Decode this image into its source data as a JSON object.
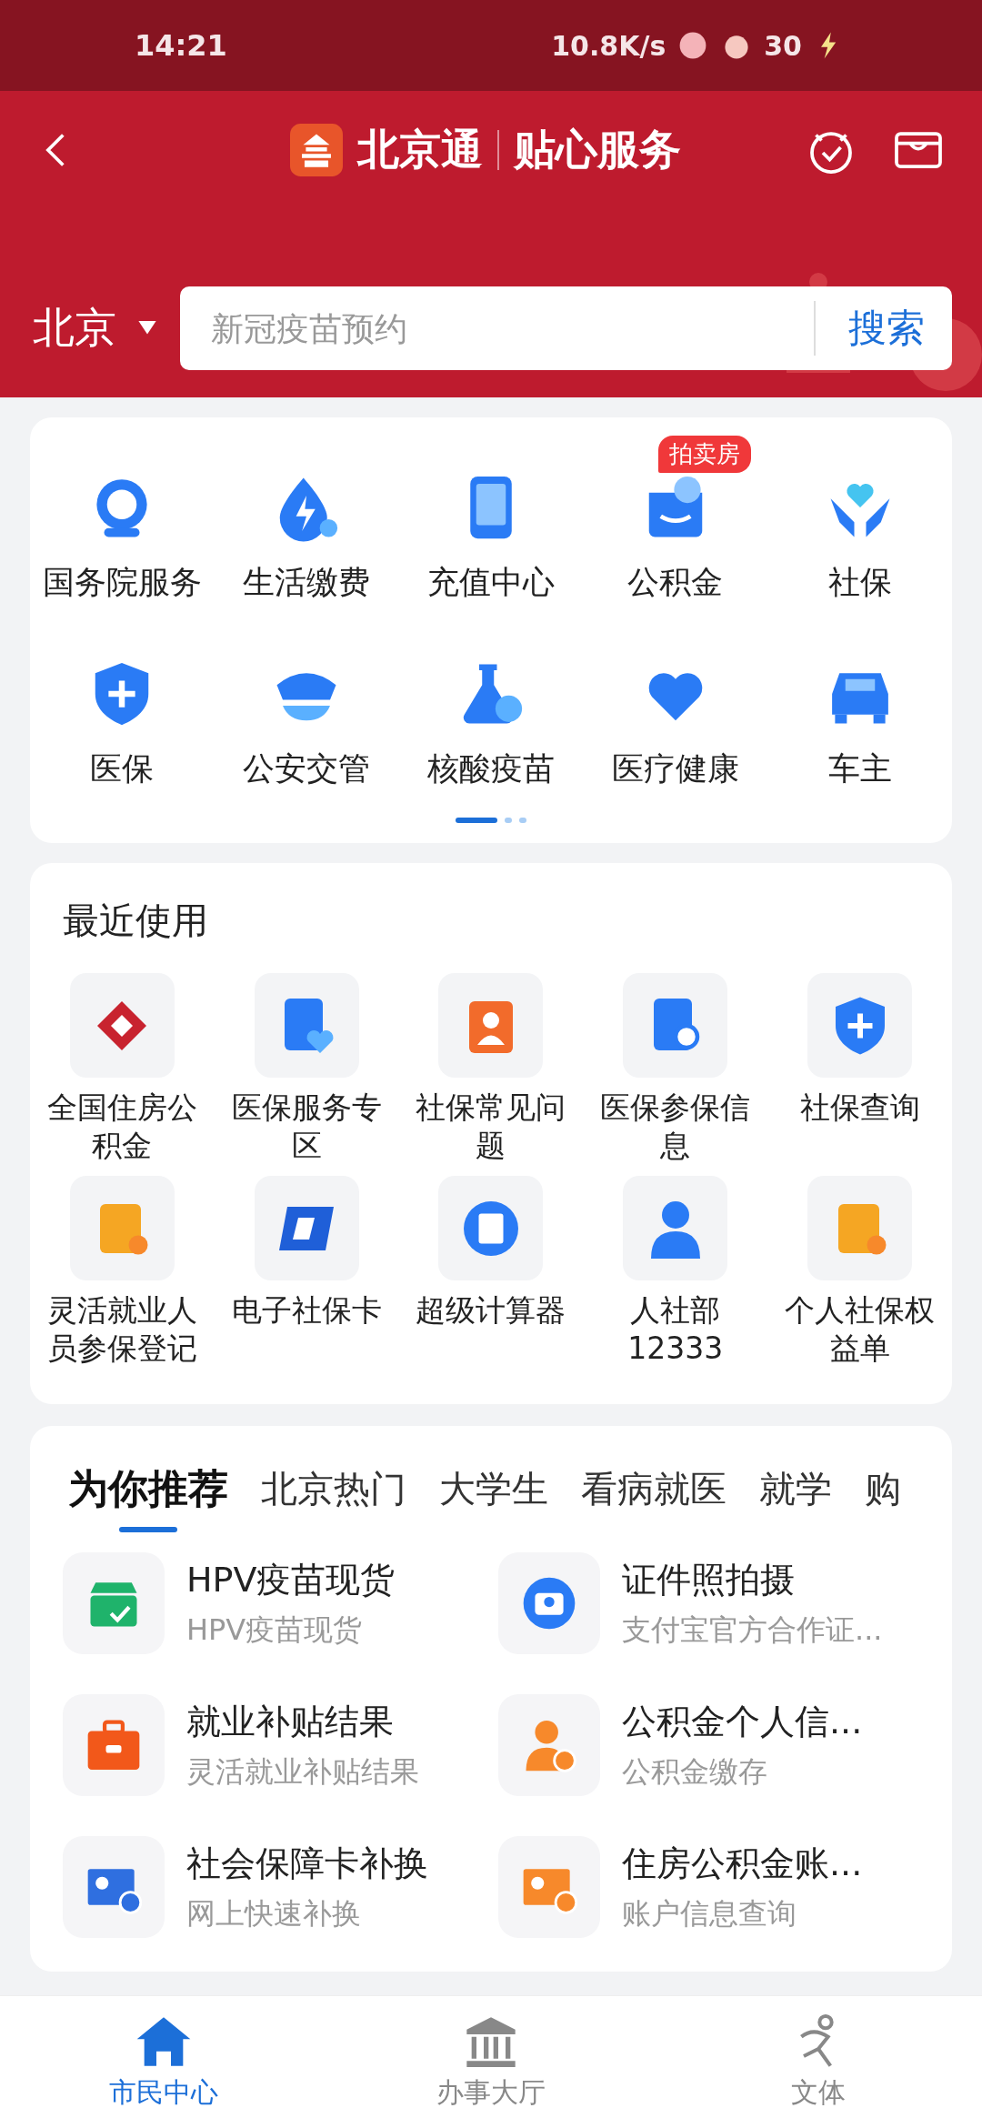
{
  "status_bar": {
    "time": "14:21",
    "net_speed": "10.8K/s",
    "battery": "30"
  },
  "header": {
    "brand": "北京通",
    "subtitle": "贴心服务",
    "city": "北京",
    "search": {
      "placeholder": "新冠疫苗预约",
      "button": "搜索"
    }
  },
  "services": {
    "items": [
      {
        "label": "国务院服务",
        "kind": "globe"
      },
      {
        "label": "生活缴费",
        "kind": "drop"
      },
      {
        "label": "充值中心",
        "kind": "phone"
      },
      {
        "label": "公积金",
        "kind": "wallet",
        "badge": "拍卖房"
      },
      {
        "label": "社保",
        "kind": "hands"
      },
      {
        "label": "医保",
        "kind": "shield"
      },
      {
        "label": "公安交管",
        "kind": "cap"
      },
      {
        "label": "核酸疫苗",
        "kind": "flask"
      },
      {
        "label": "医疗健康",
        "kind": "heart"
      },
      {
        "label": "车主",
        "kind": "car"
      }
    ],
    "pages": [
      {
        "selected": true
      },
      {
        "selected": false
      },
      {
        "selected": false
      }
    ]
  },
  "recent": {
    "title": "最近使用",
    "items": [
      {
        "label": "全国住房公积金",
        "kind": "housing"
      },
      {
        "label": "医保服务专区",
        "kind": "docheart"
      },
      {
        "label": "社保常见问题",
        "kind": "badge"
      },
      {
        "label": "医保参保信息",
        "kind": "docsearch"
      },
      {
        "label": "社保查询",
        "kind": "shield"
      },
      {
        "label": "灵活就业人员参保登记",
        "kind": "orangedoc"
      },
      {
        "label": "电子社保卡",
        "kind": "card"
      },
      {
        "label": "超级计算器",
        "kind": "calc"
      },
      {
        "label": "人社部12333",
        "kind": "person"
      },
      {
        "label": "个人社保权益单",
        "kind": "orangedoc"
      }
    ]
  },
  "recommend": {
    "tabs": [
      {
        "label": "为你推荐",
        "selected": true
      },
      {
        "label": "北京热门",
        "selected": false
      },
      {
        "label": "大学生",
        "selected": false
      },
      {
        "label": "看病就医",
        "selected": false
      },
      {
        "label": "就学",
        "selected": false
      },
      {
        "label": "购",
        "selected": false
      }
    ],
    "items": [
      {
        "title": "HPV疫苗现货",
        "subtitle": "HPV疫苗现货",
        "kind": "box"
      },
      {
        "title": "证件照拍摄",
        "subtitle": "支付宝官方合作证...",
        "kind": "camera"
      },
      {
        "title": "就业补贴结果",
        "subtitle": "灵活就业补贴结果",
        "kind": "briefcase"
      },
      {
        "title": "公积金个人信...",
        "subtitle": "公积金缴存",
        "kind": "personminus"
      },
      {
        "title": "社会保障卡补换",
        "subtitle": "网上快速补换",
        "kind": "idcard"
      },
      {
        "title": "住房公积金账...",
        "subtitle": "账户信息查询",
        "kind": "orangecard"
      }
    ]
  },
  "tabbar": [
    {
      "label": "市民中心",
      "kind": "home",
      "selected": true
    },
    {
      "label": "办事大厅",
      "kind": "hall",
      "selected": false
    },
    {
      "label": "文体",
      "kind": "runner",
      "selected": false
    }
  ]
}
